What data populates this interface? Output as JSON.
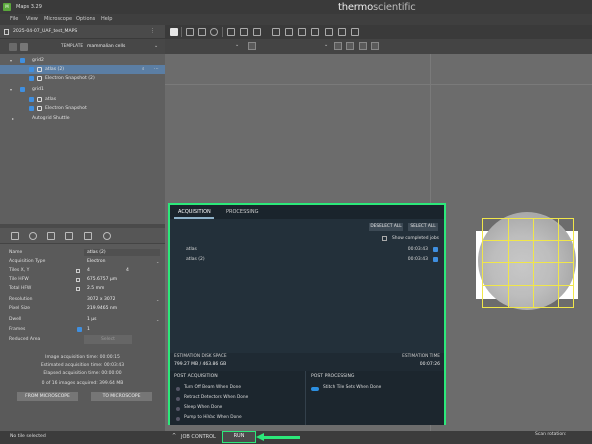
{
  "app": {
    "title": "Maps 3.29",
    "icon": "maps-app-icon",
    "brand_a": "thermo",
    "brand_b": "scientific"
  },
  "menu": [
    "File",
    "View",
    "Microscope",
    "Options",
    "Help"
  ],
  "project": {
    "name": "2025-04-07_UAF_test_MAPS"
  },
  "template": {
    "label": "TEMPLATE",
    "value": "mammalian cells"
  },
  "tree": [
    {
      "label": "grid2"
    },
    {
      "label": "atlas (2)"
    },
    {
      "label": "Electron Snapshot (2)"
    },
    {
      "label": "grid1"
    },
    {
      "label": "atlas"
    },
    {
      "label": "Electron Snapshot"
    },
    {
      "label": "Autogrid Shuttle"
    }
  ],
  "props": {
    "name": {
      "label": "Name",
      "value": "atlas (2)"
    },
    "acq_type": {
      "label": "Acquisition Type",
      "value": "Electron"
    },
    "tiles": {
      "label": "Tiles X, Y",
      "x": "4",
      "y": "4"
    },
    "tile_hfw": {
      "label": "Tile HFW",
      "value": "675.6757 µm"
    },
    "total_hfw": {
      "label": "Total HFW",
      "value": "2.5 mm"
    },
    "resolution": {
      "label": "Resolution",
      "value": "3072 x 3072"
    },
    "pixel_size": {
      "label": "Pixel Size",
      "value": "219.9465 nm"
    },
    "dwell": {
      "label": "Dwell",
      "value": "1 µs"
    },
    "frames": {
      "label": "Frames",
      "value": "1"
    },
    "reduced_area": {
      "label": "Reduced Area",
      "button": "Select"
    },
    "image_time": "Image acquisition time: 00:00:15",
    "estimated_time": "Estimated acquisition time: 00:03:43",
    "elapsed_time": "Elapsed acquisition time: 00:00:00",
    "images_acquired": "0 of 16 images acquired: 399.64 MB",
    "from_microscope": "FROM MICROSCOPE",
    "to_microscope": "TO MICROSCOPE"
  },
  "job": {
    "tabs": [
      "ACQUISITION",
      "PROCESSING"
    ],
    "deselect_all": "DESELECT ALL",
    "select_all": "SELECT ALL",
    "show_completed": "Show completed jobs",
    "rows": [
      {
        "name": "atlas",
        "time": "00:03:43"
      },
      {
        "name": "atlas (2)",
        "time": "00:03:43"
      }
    ],
    "est_disk_label": "ESTIMATION DISK SPACE",
    "est_disk_value": "799.27 MB / 463.86 GB",
    "est_time_label": "ESTIMATION TIME",
    "est_time_value": "00:07:26",
    "post_acq_title": "POST ACQUISITION",
    "post_acq_items": [
      "Turn Off Beam When Done",
      "Retract Detectors When Done",
      "Sleep When Done",
      "Pump to HiVac When Done"
    ],
    "post_proc_title": "POST PROCESSING",
    "post_proc_items": [
      "Stitch Tile Sets When Done"
    ]
  },
  "status": {
    "left": "No tile selected",
    "job_control": "JOB CONTROL",
    "run": "RUN",
    "scan_rotation": "Scan rotation:"
  },
  "colors": {
    "highlight": "#2ce87a",
    "selection": "#5b7ea4",
    "checkbox": "#3f8fe0",
    "tile_outline": "#f0e64a"
  }
}
